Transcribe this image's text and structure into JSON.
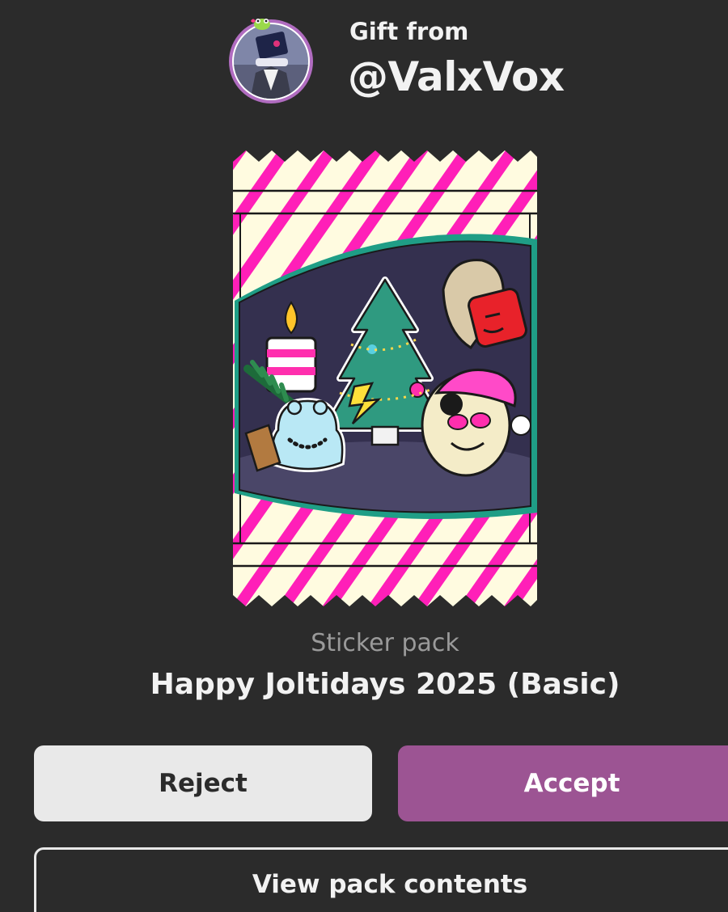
{
  "header": {
    "gift_from_label": "Gift from",
    "sender_handle": "@ValxVox"
  },
  "pack": {
    "type_label": "Sticker pack",
    "name": "Happy Joltidays 2025 (Basic)"
  },
  "actions": {
    "reject_label": "Reject",
    "accept_label": "Accept",
    "view_contents_label": "View pack contents"
  },
  "colors": {
    "background": "#2b2b2b",
    "accept": "#9c5493",
    "reject": "#e9e9e9",
    "wrapper_stripe": "#ff1fb8",
    "wrapper_base": "#fffbe0",
    "window_ring": "#1f9e86"
  }
}
